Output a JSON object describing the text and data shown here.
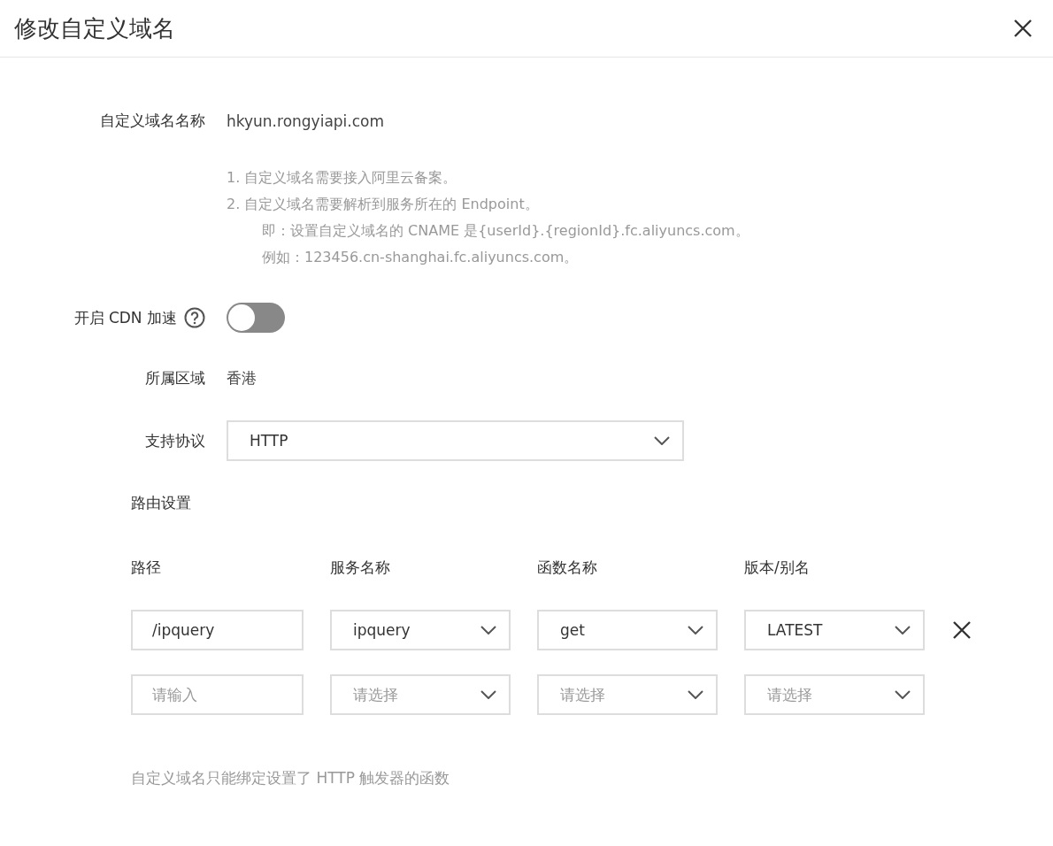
{
  "dialog": {
    "title": "修改自定义域名"
  },
  "domain": {
    "label": "自定义域名名称",
    "value": "hkyun.rongyiapi.com"
  },
  "notes": [
    {
      "kind": "item",
      "text": "1. 自定义域名需要接入阿里云备案。"
    },
    {
      "kind": "item",
      "text": "2. 自定义域名需要解析到服务所在的 Endpoint。"
    },
    {
      "kind": "sub",
      "text": "即：设置自定义域名的 CNAME 是{userId}.{regionId}.fc.aliyuncs.com。"
    },
    {
      "kind": "sub",
      "text": "例如：123456.cn-shanghai.fc.aliyuncs.com。"
    }
  ],
  "cdn": {
    "label": "开启 CDN 加速",
    "on": false
  },
  "region": {
    "label": "所属区域",
    "value": "香港"
  },
  "protocol": {
    "label": "支持协议",
    "value": "HTTP"
  },
  "routes": {
    "title": "路由设置",
    "columns": [
      "路径",
      "服务名称",
      "函数名称",
      "版本/别名"
    ],
    "rows": [
      {
        "removable": true,
        "cells": [
          {
            "value": "/ipquery"
          },
          {
            "value": "ipquery"
          },
          {
            "value": "get"
          },
          {
            "value": "LATEST"
          }
        ]
      },
      {
        "removable": false,
        "cells": [
          {
            "placeholder": "请输入"
          },
          {
            "placeholder": "请选择"
          },
          {
            "placeholder": "请选择"
          },
          {
            "placeholder": "请选择"
          }
        ]
      }
    ]
  },
  "footer_note": "自定义域名只能绑定设置了 HTTP 触发器的函数"
}
